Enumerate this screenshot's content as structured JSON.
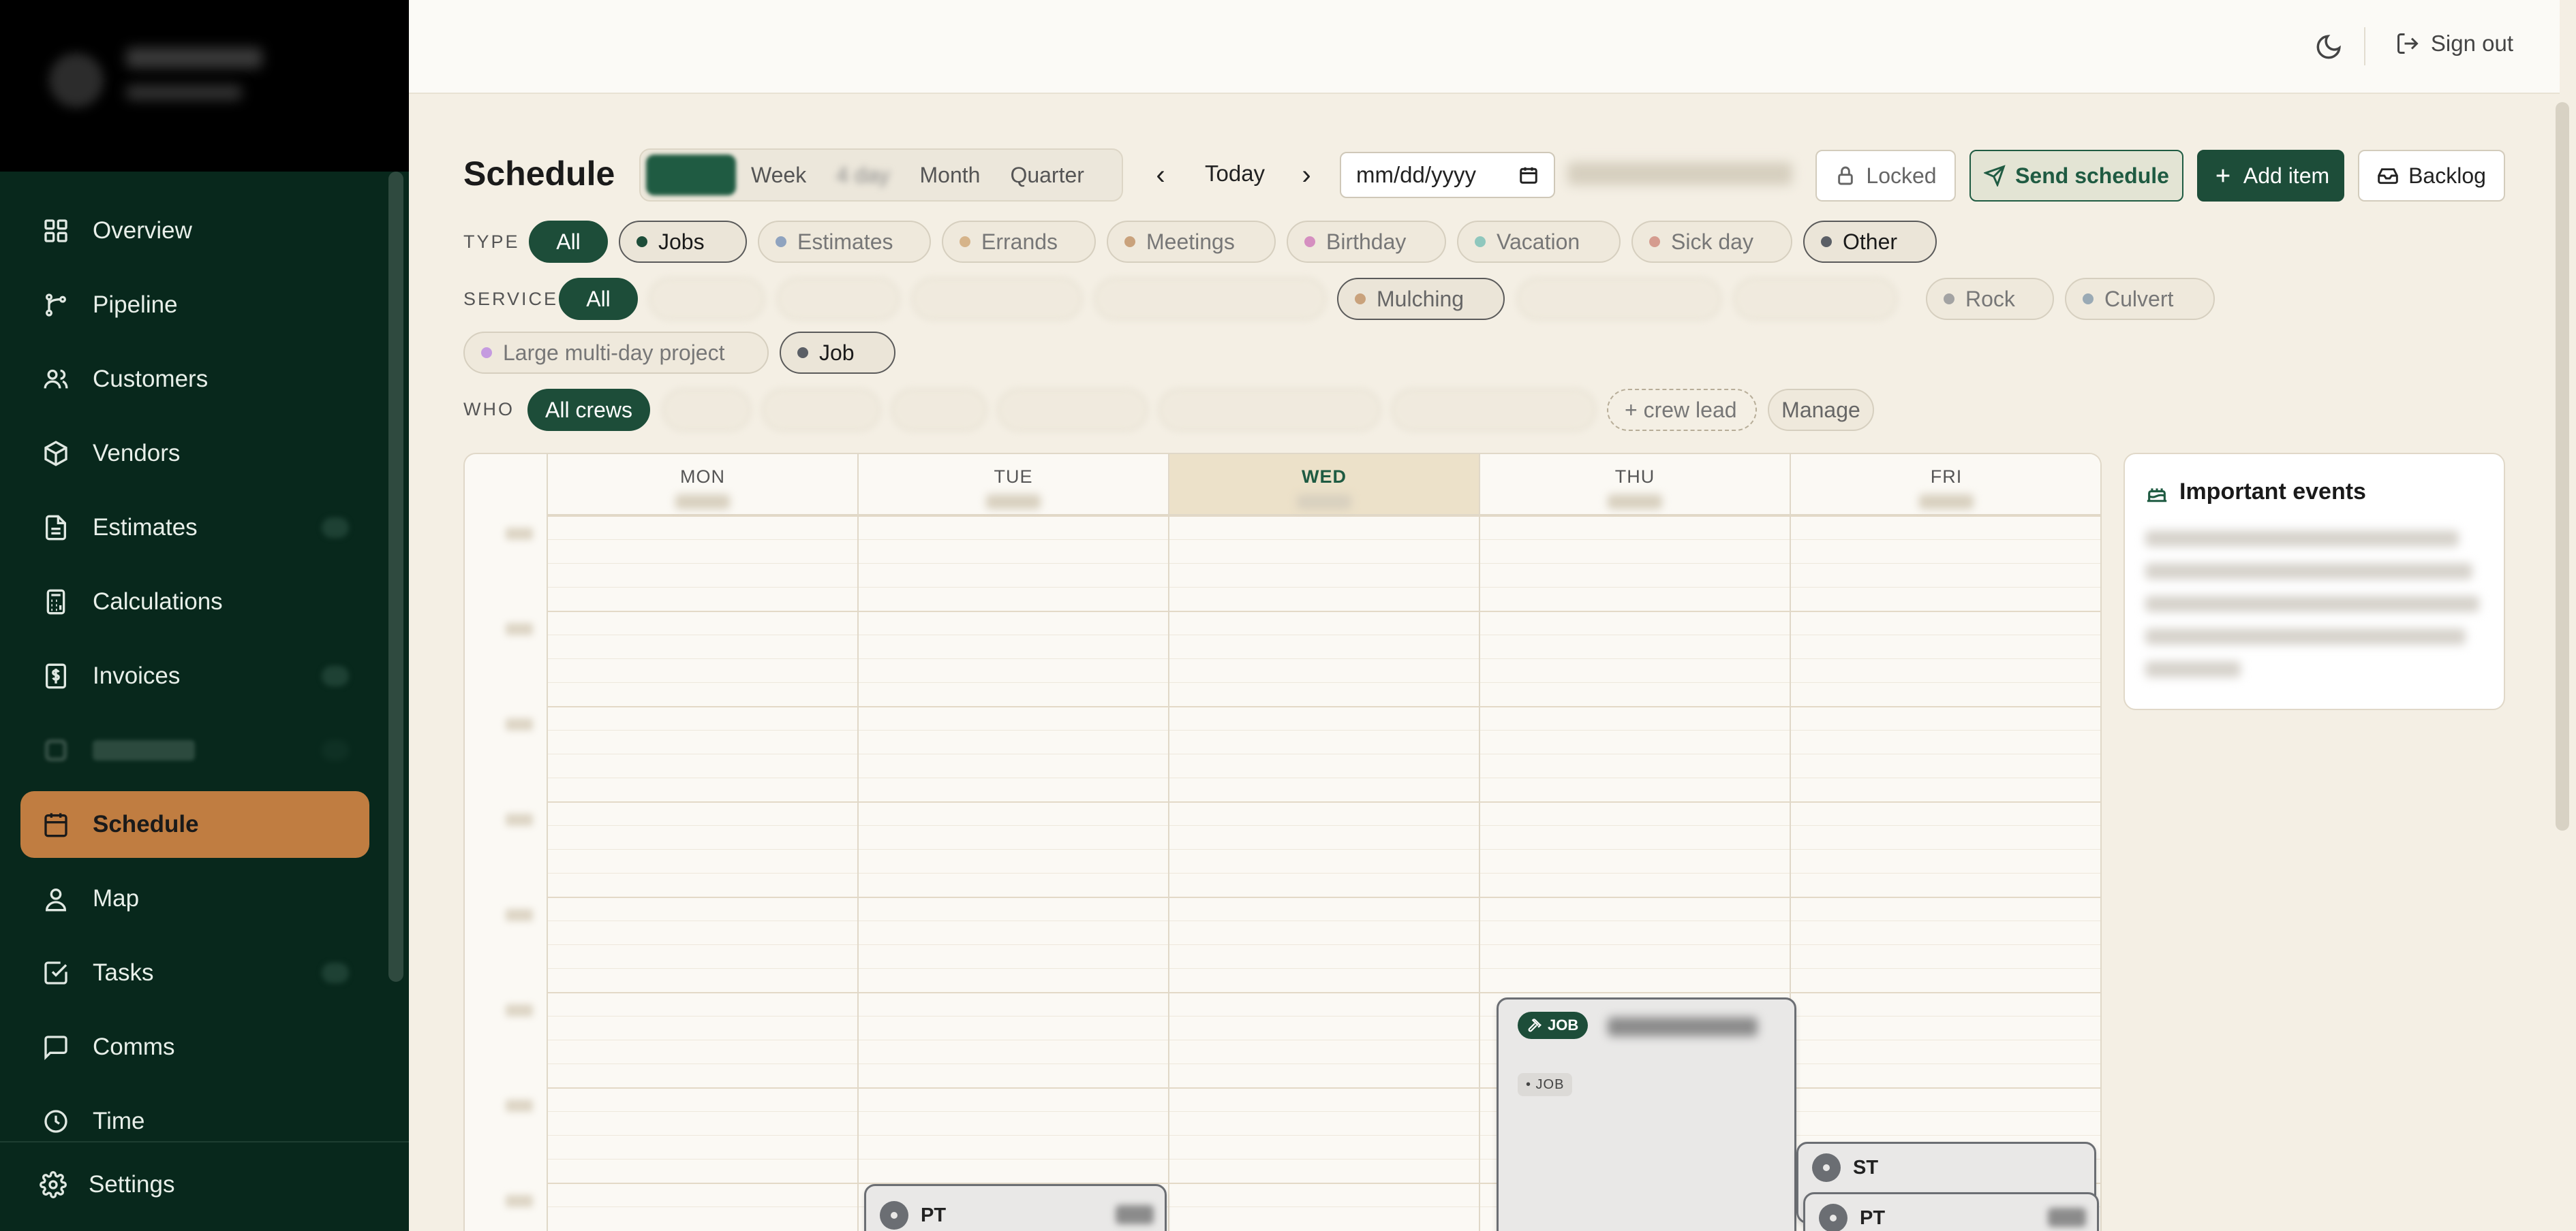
{
  "sidebar": {
    "items": [
      {
        "label": "Overview",
        "icon": "grid-icon"
      },
      {
        "label": "Pipeline",
        "icon": "pipeline-icon"
      },
      {
        "label": "Customers",
        "icon": "users-icon"
      },
      {
        "label": "Vendors",
        "icon": "package-icon"
      },
      {
        "label": "Estimates",
        "icon": "document-icon"
      },
      {
        "label": "Calculations",
        "icon": "calculator-icon"
      },
      {
        "label": "Invoices",
        "icon": "dollar-icon"
      },
      {
        "label": "Schedule",
        "icon": "calendar-icon"
      },
      {
        "label": "Map",
        "icon": "map-pin-icon"
      },
      {
        "label": "Tasks",
        "icon": "checkbox-icon"
      },
      {
        "label": "Comms",
        "icon": "chat-icon"
      },
      {
        "label": "Time",
        "icon": "clock-icon"
      }
    ],
    "settings_label": "Settings",
    "active_color": "#c07d41",
    "background_color": "#08281c"
  },
  "topbar": {
    "signout_label": "Sign out"
  },
  "header": {
    "title": "Schedule",
    "views": [
      "Week",
      "Month",
      "Quarter"
    ],
    "today_label": "Today",
    "date_placeholder": "mm/dd/yyyy",
    "buttons": {
      "locked": "Locked",
      "send": "Send schedule",
      "add": "Add item",
      "backlog": "Backlog"
    }
  },
  "filters": {
    "type_label": "TYPE",
    "type_chips": [
      {
        "label": "All",
        "color": ""
      },
      {
        "label": "Jobs",
        "color": "#1d4d39"
      },
      {
        "label": "Estimates",
        "color": "#8fa3bf"
      },
      {
        "label": "Errands",
        "color": "#d6b48a"
      },
      {
        "label": "Meetings",
        "color": "#c9a27c"
      },
      {
        "label": "Birthday",
        "color": "#d58fc0"
      },
      {
        "label": "Vacation",
        "color": "#8fc7bd"
      },
      {
        "label": "Sick day",
        "color": "#d59c8f"
      },
      {
        "label": "Other",
        "color": "#5b5f66"
      }
    ],
    "service_label": "SERVICE",
    "service_chips": [
      {
        "label": "All",
        "color": ""
      },
      {
        "label": "Mulching",
        "color": "#c9a27c"
      },
      {
        "label": "Rock",
        "color": "#a3a3a3"
      },
      {
        "label": "Culvert",
        "color": "#9aaab5"
      },
      {
        "label": "Large multi-day project",
        "color": "#c59be0"
      },
      {
        "label": "Job",
        "color": "#5b5f66"
      }
    ],
    "who_label": "WHO",
    "who_chips": [
      {
        "label": "All crews"
      },
      {
        "label": "+ crew lead"
      },
      {
        "label": "Manage"
      }
    ]
  },
  "calendar": {
    "days": [
      "MON",
      "TUE",
      "WED",
      "THU",
      "FRI"
    ],
    "today_index": 2,
    "events": [
      {
        "badge": "JOB",
        "tag": "• JOB"
      },
      {
        "initials": "PT"
      },
      {
        "initials": "ST"
      },
      {
        "initials": "PT"
      }
    ]
  },
  "important": {
    "title": "Important events"
  }
}
